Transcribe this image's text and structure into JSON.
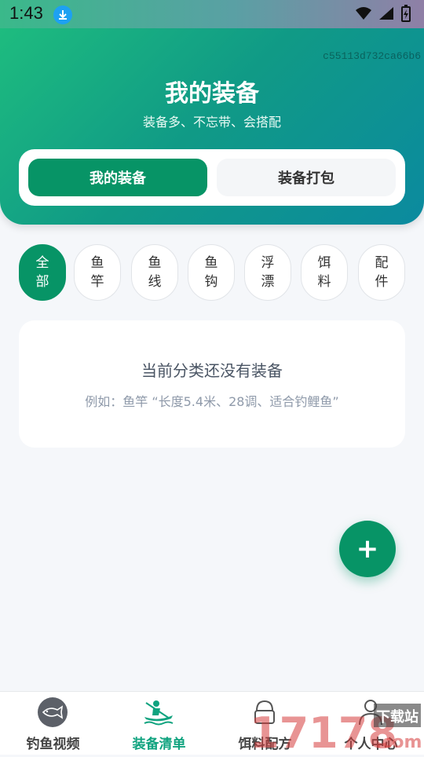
{
  "status": {
    "time": "1:43"
  },
  "header": {
    "hash": "c55113d732ca66b6",
    "title": "我的装备",
    "subtitle": "装备多、不忘带、会搭配"
  },
  "segments": {
    "my_gear": "我的装备",
    "gear_pack": "装备打包"
  },
  "categories": [
    "全部",
    "鱼竿",
    "鱼线",
    "鱼钩",
    "浮漂",
    "饵料",
    "配件"
  ],
  "empty": {
    "title": "当前分类还没有装备",
    "hint": "例如：鱼竿 “长度5.4米、28调、适合钓鲤鱼”"
  },
  "fab": {
    "label": "+"
  },
  "tabs": [
    {
      "label": "钓鱼视频",
      "icon": "fish-icon"
    },
    {
      "label": "装备清单",
      "icon": "kayak-icon"
    },
    {
      "label": "饵料配方",
      "icon": "bait-icon"
    },
    {
      "label": "个人中心",
      "icon": "person-icon"
    }
  ],
  "watermark": {
    "brand": "17178",
    "tag": "下载站",
    "suffix": ".com"
  },
  "colors": {
    "primary": "#079466",
    "accent": "#10a37f",
    "header_start": "#1fbf7e",
    "header_end": "#0b8a9f"
  }
}
